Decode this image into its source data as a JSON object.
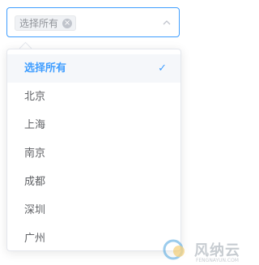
{
  "select": {
    "tag_label": "选择所有",
    "tag_close_icon": "close-circle-icon",
    "arrow_icon": "chevron-up-icon",
    "accent_color": "#409eff"
  },
  "dropdown": {
    "items": [
      {
        "label": "选择所有",
        "selected": true
      },
      {
        "label": "北京",
        "selected": false
      },
      {
        "label": "上海",
        "selected": false
      },
      {
        "label": "南京",
        "selected": false
      },
      {
        "label": "成都",
        "selected": false
      },
      {
        "label": "深圳",
        "selected": false
      },
      {
        "label": "广州",
        "selected": false
      }
    ],
    "check_icon": "check-icon"
  },
  "watermark": {
    "text": "风纳云",
    "sub": "FENGNAYUN.COM"
  }
}
